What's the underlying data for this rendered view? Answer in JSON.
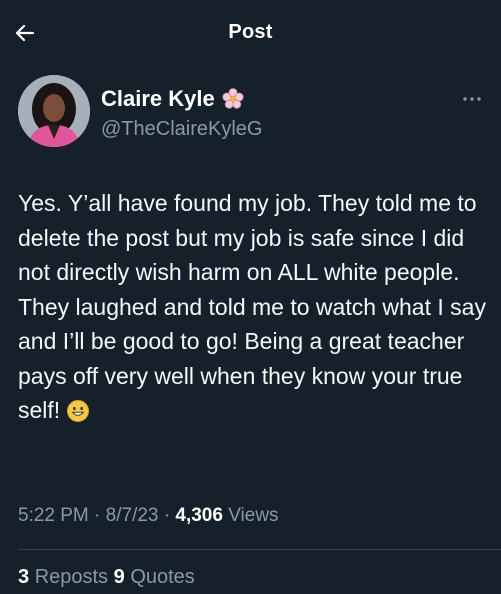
{
  "header": {
    "title": "Post",
    "back_icon": "arrow-left-icon"
  },
  "author": {
    "display_name": "Claire Kyle",
    "handle": "@TheClaireKyleG",
    "badge_icon": "flower-emoji-icon",
    "more_icon": "more-horizontal-icon"
  },
  "post": {
    "text": "Yes. Y’all have found my job. They told me to delete the post but my job is safe since I did not directly wish harm on ALL white people. They laughed and told me to watch what I say and I’ll be good to go! Being a great teacher pays off very well when they know your true self!",
    "emoji_icon": "grinning-face-emoji-icon"
  },
  "meta": {
    "time": "5:22 PM",
    "sep1": " · ",
    "date": "8/7/23",
    "sep2": " · ",
    "views_count": "4,306",
    "views_label": " Views"
  },
  "stats": {
    "reposts_count": "3",
    "reposts_label": "Reposts",
    "quotes_count": "9",
    "quotes_label": "Quotes"
  },
  "colors": {
    "background": "#15202b",
    "text": "#ffffff",
    "secondary": "#8b98a5",
    "divider": "#38444d"
  }
}
